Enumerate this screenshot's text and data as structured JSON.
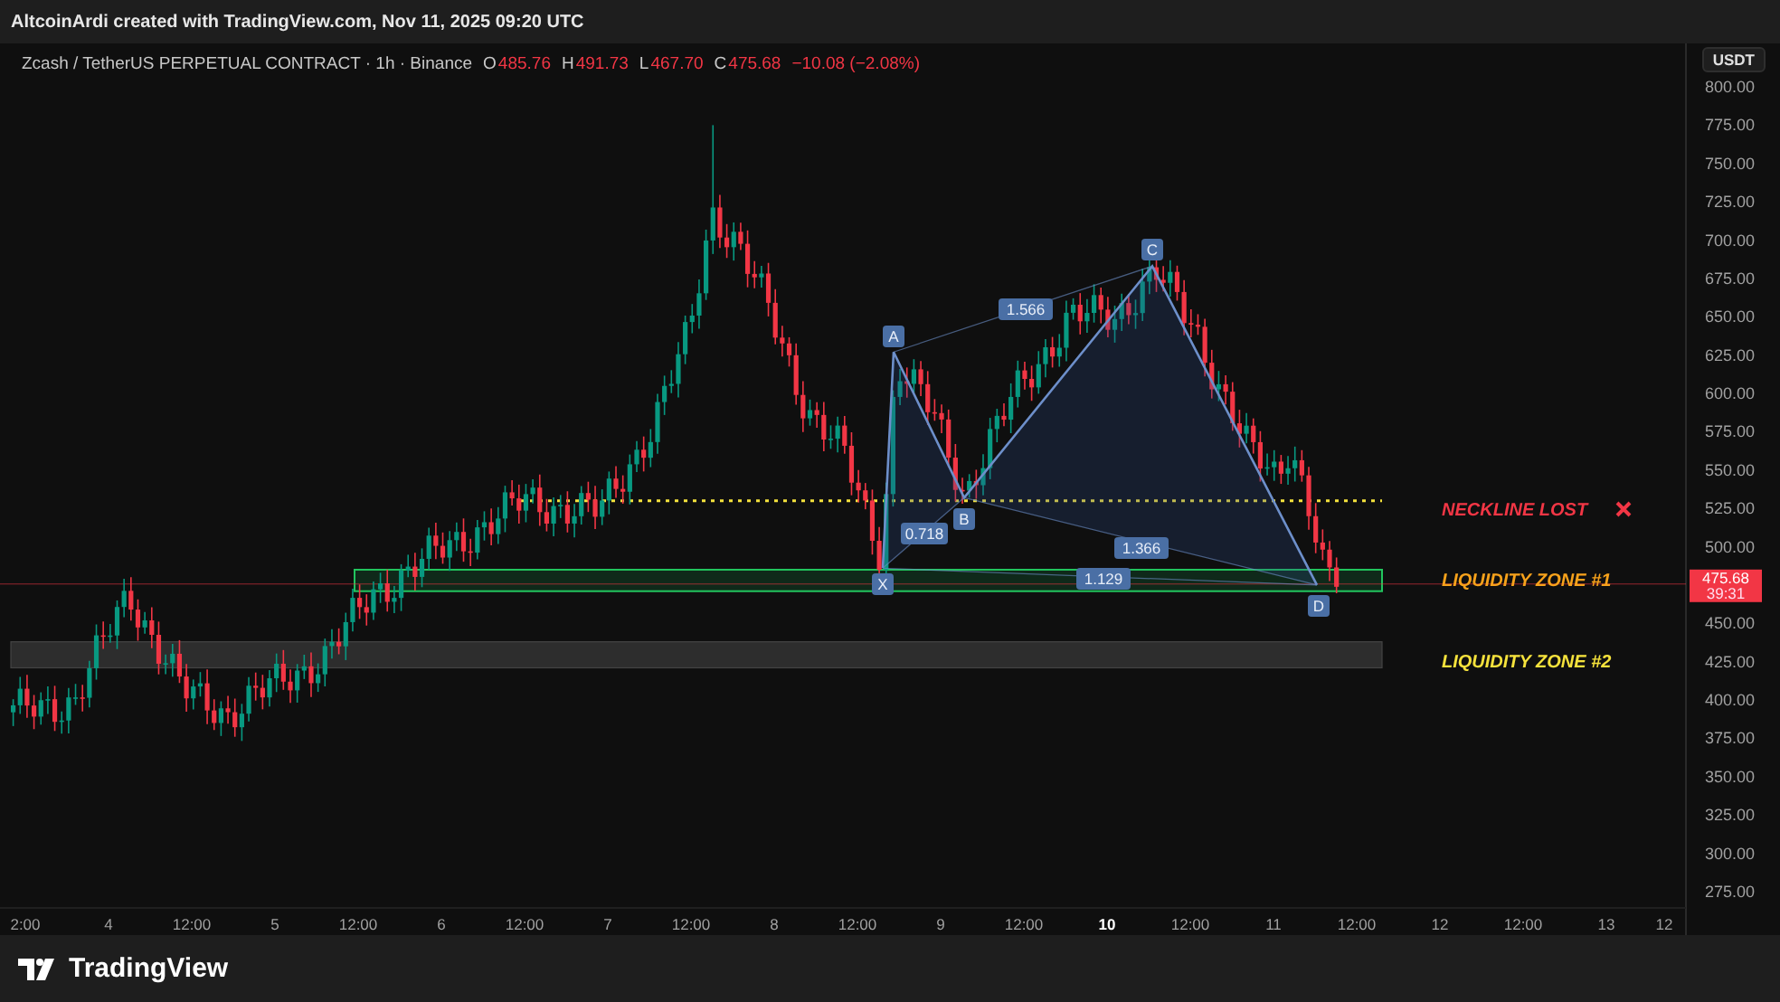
{
  "top_bar": {
    "credit": "AltcoinArdi created with TradingView.com, Nov 11, 2025 09:20 UTC"
  },
  "legend": {
    "symbol": "Zcash / TetherUS PERPETUAL CONTRACT · 1h · Binance",
    "ohlc": [
      {
        "label": "O",
        "value": "485.76"
      },
      {
        "label": "H",
        "value": "491.73"
      },
      {
        "label": "L",
        "value": "467.70"
      },
      {
        "label": "C",
        "value": "475.68"
      }
    ],
    "change": "−10.08 (−2.08%)"
  },
  "currency_button": "USDT",
  "price_axis": [
    "800.00",
    "775.00",
    "750.00",
    "725.00",
    "700.00",
    "675.00",
    "650.00",
    "625.00",
    "600.00",
    "575.00",
    "550.00",
    "525.00",
    "500.00",
    "450.00",
    "425.00",
    "400.00",
    "375.00",
    "350.00",
    "325.00",
    "300.00",
    "275.00"
  ],
  "price_tag": {
    "price": "475.68",
    "countdown": "39:31"
  },
  "time_axis": [
    {
      "label": "2:00",
      "highlighted": false
    },
    {
      "label": "4",
      "highlighted": false
    },
    {
      "label": "12:00",
      "highlighted": false
    },
    {
      "label": "5",
      "highlighted": false
    },
    {
      "label": "12:00",
      "highlighted": false
    },
    {
      "label": "6",
      "highlighted": false
    },
    {
      "label": "12:00",
      "highlighted": false
    },
    {
      "label": "7",
      "highlighted": false
    },
    {
      "label": "12:00",
      "highlighted": false
    },
    {
      "label": "8",
      "highlighted": false
    },
    {
      "label": "12:00",
      "highlighted": false
    },
    {
      "label": "9",
      "highlighted": false
    },
    {
      "label": "12:00",
      "highlighted": false
    },
    {
      "label": "10",
      "highlighted": true
    },
    {
      "label": "12:00",
      "highlighted": false
    },
    {
      "label": "11",
      "highlighted": false
    },
    {
      "label": "12:00",
      "highlighted": false
    },
    {
      "label": "12",
      "highlighted": false
    },
    {
      "label": "12:00",
      "highlighted": false
    },
    {
      "label": "13",
      "highlighted": false
    },
    {
      "label": "12",
      "highlighted": false
    }
  ],
  "pattern": {
    "points": [
      "X",
      "A",
      "B",
      "C",
      "D"
    ],
    "ratios": [
      "0.718",
      "1.566",
      "1.366",
      "1.129"
    ]
  },
  "annotations": [
    {
      "kind": "neckline",
      "text": "NECKLINE LOST",
      "color": "#f23645"
    },
    {
      "kind": "zone1",
      "text": "LIQUIDITY ZONE #1",
      "color": "#f7a21b"
    },
    {
      "kind": "zone2",
      "text": "LIQUIDITY ZONE #2",
      "color": "#f5e23c"
    }
  ],
  "footer": {
    "brand": "TradingView"
  }
}
